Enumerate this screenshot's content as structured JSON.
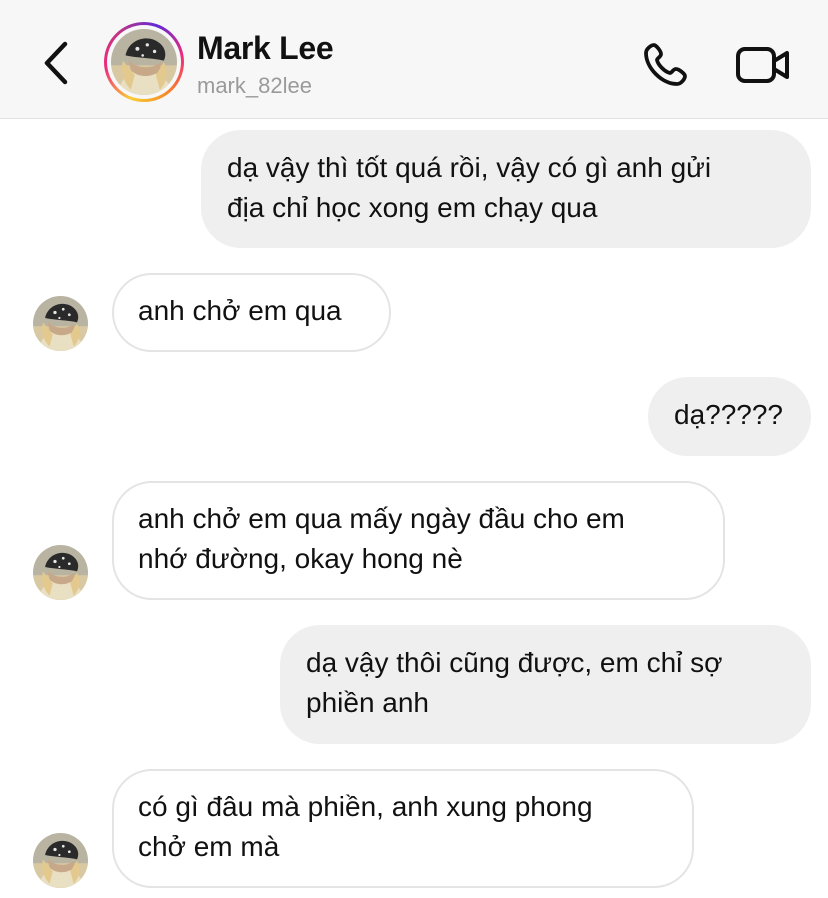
{
  "header": {
    "name": "Mark Lee",
    "username": "mark_82lee",
    "back_icon": "chevron-left-icon",
    "call_icon": "phone-icon",
    "video_icon": "video-camera-icon"
  },
  "messages": [
    {
      "direction": "outgoing",
      "text": "dạ vậy thì tốt quá rồi, vậy có gì anh gửi\nđịa chỉ học xong em chạy qua"
    },
    {
      "direction": "incoming",
      "text": "anh chở em qua"
    },
    {
      "direction": "outgoing",
      "text": "dạ?????"
    },
    {
      "direction": "incoming",
      "text": "anh chở em qua mấy ngày đầu cho em\nnhớ đường, okay hong nè"
    },
    {
      "direction": "outgoing",
      "text": "dạ vậy thôi cũng được, em chỉ sợ\nphiền anh"
    },
    {
      "direction": "incoming",
      "text": "có gì đâu mà phiền, anh xung phong\nchở em mà"
    }
  ],
  "colors": {
    "outgoing_bubble": "#efefef",
    "incoming_border": "#e4e4e4",
    "header_bg": "#f7f7f7",
    "username": "#9a9a9a"
  }
}
